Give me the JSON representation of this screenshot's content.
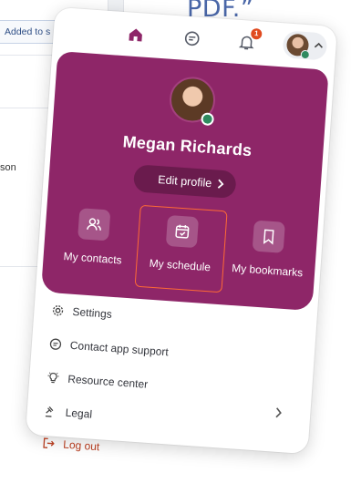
{
  "background": {
    "title_fragment": "PDF.”",
    "chip_label": "Added to s",
    "text_fragment": "son"
  },
  "topbar": {
    "icons": [
      "home-icon",
      "chat-icon",
      "bell-icon"
    ],
    "notification_count": "1"
  },
  "profile": {
    "name": "Megan Richards",
    "edit_label": "Edit profile",
    "status": "online"
  },
  "tiles": [
    {
      "label": "My contacts",
      "icon": "people-icon"
    },
    {
      "label": "My schedule",
      "icon": "calendar-check-icon",
      "selected": true
    },
    {
      "label": "My bookmarks",
      "icon": "bookmark-icon"
    }
  ],
  "menu": {
    "items": [
      {
        "label": "Settings",
        "icon": "gear-icon"
      },
      {
        "label": "Contact app support",
        "icon": "support-chat-icon"
      },
      {
        "label": "Resource center",
        "icon": "lightbulb-icon"
      },
      {
        "label": "Legal",
        "icon": "gavel-icon"
      },
      {
        "label": "Log out",
        "icon": "logout-icon"
      }
    ]
  },
  "colors": {
    "brand": "#8e2668",
    "brand_dark": "#6a1b4d",
    "highlight": "#ff6a35",
    "logout": "#b23a1d",
    "online": "#2f8a5f",
    "badge": "#e04a1f"
  }
}
